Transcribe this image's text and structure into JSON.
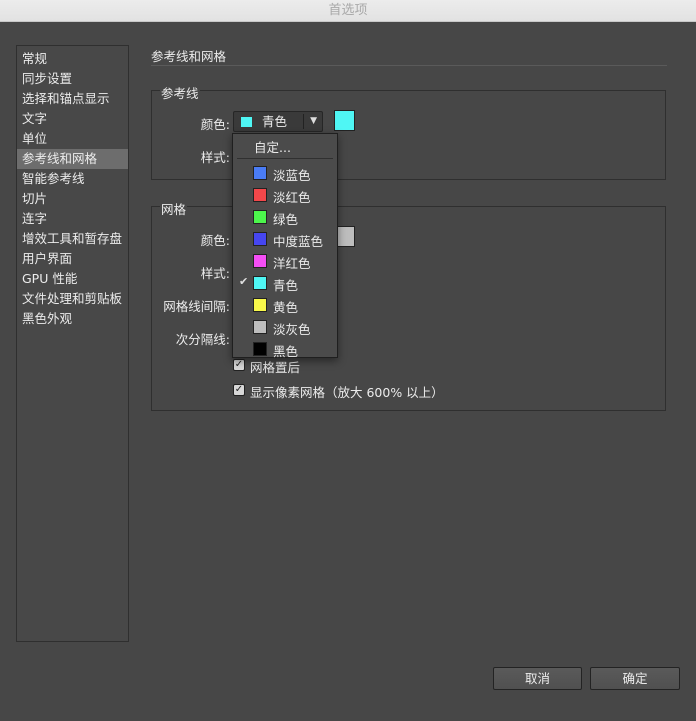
{
  "window": {
    "title": "首选项"
  },
  "sidebar": {
    "items": [
      {
        "label": "常规"
      },
      {
        "label": "同步设置"
      },
      {
        "label": "选择和锚点显示"
      },
      {
        "label": "文字"
      },
      {
        "label": "单位"
      },
      {
        "label": "参考线和网格"
      },
      {
        "label": "智能参考线"
      },
      {
        "label": "切片"
      },
      {
        "label": "连字"
      },
      {
        "label": "增效工具和暂存盘"
      },
      {
        "label": "用户界面"
      },
      {
        "label": "GPU 性能"
      },
      {
        "label": "文件处理和剪贴板"
      },
      {
        "label": "黑色外观"
      }
    ],
    "selected_index": 5
  },
  "section": {
    "title": "参考线和网格"
  },
  "guides": {
    "label": "参考线",
    "color_label": "颜色:",
    "color_value": "青色",
    "style_label": "样式:",
    "swatch_color": "#4ff6f4"
  },
  "dropdown": {
    "custom_label": "自定...",
    "options": [
      {
        "label": "淡蓝色",
        "color": "#4a7cf5",
        "checked": false
      },
      {
        "label": "淡红色",
        "color": "#f2474a",
        "checked": false
      },
      {
        "label": "绿色",
        "color": "#4cf64c",
        "checked": false
      },
      {
        "label": "中度蓝色",
        "color": "#4646f0",
        "checked": false
      },
      {
        "label": "洋红色",
        "color": "#f54ef5",
        "checked": false
      },
      {
        "label": "青色",
        "color": "#4ff6f4",
        "checked": true
      },
      {
        "label": "黄色",
        "color": "#f8f84a",
        "checked": false
      },
      {
        "label": "淡灰色",
        "color": "#bdbdbd",
        "checked": false
      },
      {
        "label": "黑色",
        "color": "#000000",
        "checked": false
      }
    ]
  },
  "grid": {
    "label": "网格",
    "color_label": "颜色:",
    "style_label": "样式:",
    "spacing_label": "网格线间隔:",
    "subdivision_label": "次分隔线:",
    "swatch_color": "#bdbdbd",
    "grids_in_back": {
      "label": "网格置后",
      "checked": true
    },
    "pixel_grid": {
      "label": "显示像素网格（放大 600% 以上）",
      "checked": true
    }
  },
  "buttons": {
    "cancel": "取消",
    "ok": "确定"
  }
}
